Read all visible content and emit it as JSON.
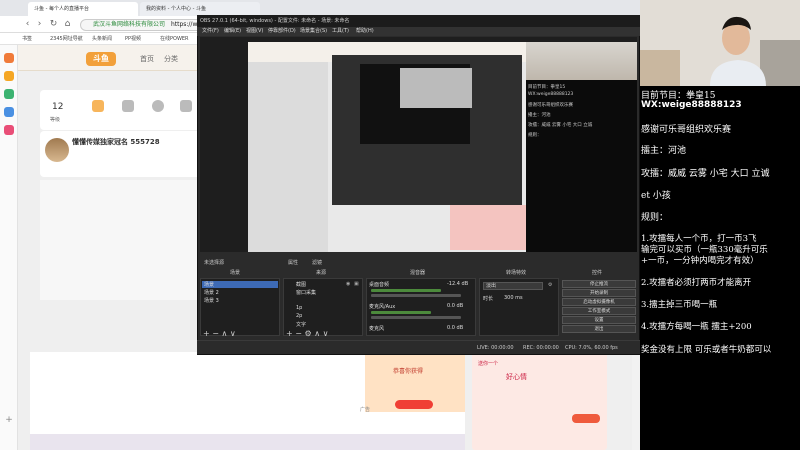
{
  "browser": {
    "tabs": [
      {
        "label": "斗鱼 - 每个人的直播平台",
        "active": true
      },
      {
        "label": "我的资料 - 个人中心 - 斗鱼",
        "active": false
      }
    ],
    "url": "https://www",
    "url_secure_note": "武汉斗鱼网络科技有限公司",
    "bookmarks": [
      "书签",
      "2345网址导航",
      "头条新闻",
      "PP视频",
      "在线POWER"
    ],
    "nav_links": [
      "首页",
      "分类"
    ],
    "logo_text": "斗鱼",
    "card_stat": {
      "value": "12",
      "label": "等级"
    },
    "streamer_title": "懂懂传媒独家冠名 555728",
    "ad_label": "广告",
    "gift_popup_text": "恭喜你获得",
    "right_card_text": "送你一个",
    "right_card_text2": "好心情"
  },
  "obs": {
    "title": "OBS 27.0.1 (64-bit, windows) - 配置文件: 未命名 - 场景: 未命名",
    "menu": [
      "文件(F)",
      "编辑(E)",
      "视图(V)",
      "停靠部件(D)",
      "场景集合(S)",
      "工具(T)",
      "帮助(H)"
    ],
    "scene_status": "未选择源",
    "props_label": "属性",
    "filters_label": "滤镜",
    "docks": {
      "scenes": {
        "title": "场景",
        "items": [
          "场景",
          "场景 2",
          "场景 3"
        ]
      },
      "sources": {
        "title": "来源",
        "items": [
          "截图",
          "窗口采集",
          "1p",
          "2p",
          "文字"
        ]
      },
      "mixer": {
        "title": "混音器",
        "channels": [
          {
            "name": "桌面音频",
            "db": "-12.4 dB"
          },
          {
            "name": "麦克风/Aux",
            "db": "0.0 dB"
          },
          {
            "name": "麦克风",
            "db": "0.0 dB"
          }
        ]
      },
      "transitions": {
        "title": "转场特效",
        "value": "淡出",
        "duration_label": "时长",
        "duration": "300 ms"
      },
      "controls": {
        "title": "控件",
        "buttons": [
          "停止推流",
          "开始录制",
          "启动虚拟摄像机",
          "工作室模式",
          "设置",
          "退出"
        ]
      }
    },
    "status": {
      "live": "LIVE: 00:00:00",
      "rec": "REC: 00:00:00",
      "cpu": "CPU: 7.0%, 60.00 fps"
    }
  },
  "preview_overlay": {
    "lines": [
      "目前节目：拳皇15",
      "WX:weige88888123",
      "感谢可乐哥组织欢乐赛",
      "播主：河池",
      "攻擂：威威 云雾 小宅 大口 立诚",
      "规则："
    ]
  },
  "overlay": {
    "program": "目前节目：拳皇15",
    "wechat": "WX:weige88888123",
    "thanks": "感谢可乐哥组织欢乐赛",
    "host": "擂主：河池",
    "challengers_1": "攻擂：威威 云雾 小宅 大口 立诚",
    "challengers_2": "et 小孩",
    "rules_title": "规则：",
    "rule_1a": "1.攻擂每人一个币，打一币3飞",
    "rule_1b": "输完可以买币（一瓶330毫升可乐",
    "rule_1c": "+一币，一分钟内喝完才有效）",
    "rule_2": "2.攻擂者必须打两币才能离开",
    "rule_3": "3.擂主掉三币喝一瓶",
    "rule_4": "4.攻擂方每喝一瓶 擂主+200",
    "reward": "奖金没有上限 可乐或者牛奶都可以"
  },
  "colors": {
    "overlay_bg": "#000000",
    "overlay_text": "#ffffff",
    "obs_bg": "#2b2b2b",
    "selected": "#3d6ab5",
    "brand_orange": "#f2a03a"
  }
}
